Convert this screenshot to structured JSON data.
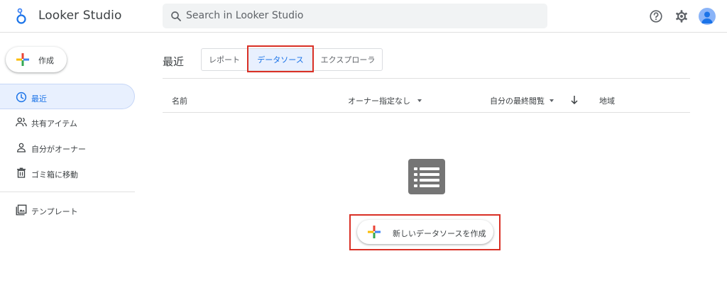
{
  "header": {
    "title": "Looker Studio",
    "search_placeholder": "Search in Looker Studio",
    "icons": [
      "help-icon",
      "settings-icon",
      "account-avatar"
    ]
  },
  "sidebar": {
    "create_label": "作成",
    "items": [
      {
        "label": "最近",
        "icon": "clock-icon",
        "active": true
      },
      {
        "label": "共有アイテム",
        "icon": "people-icon",
        "active": false
      },
      {
        "label": "自分がオーナー",
        "icon": "person-icon",
        "active": false
      },
      {
        "label": "ゴミ箱に移動",
        "icon": "trash-icon",
        "active": false
      },
      {
        "label": "テンプレート",
        "icon": "template-icon",
        "active": false
      }
    ]
  },
  "main": {
    "section_title": "最近",
    "tabs": [
      {
        "label": "レポート",
        "selected": false
      },
      {
        "label": "データソース",
        "selected": true
      },
      {
        "label": "エクスプローラ",
        "selected": false
      }
    ],
    "columns": {
      "name": "名前",
      "owner": "オーナー指定なし",
      "last_viewed": "自分の最終閲覧",
      "region": "地域"
    },
    "new_datasource_label": "新しいデータソースを作成"
  },
  "colors": {
    "accent": "#1a73e8",
    "active_bg": "#e8f0fe",
    "highlight": "#d93025",
    "empty_icon": "#757575"
  }
}
